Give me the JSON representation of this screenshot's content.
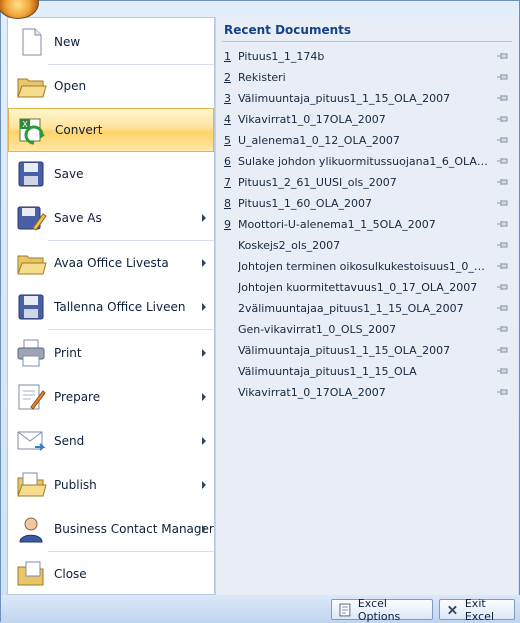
{
  "menu": {
    "items": [
      {
        "label": "New",
        "icon": "new-document-icon",
        "submenu": false
      },
      {
        "label": "Open",
        "icon": "open-folder-icon",
        "submenu": false
      },
      {
        "label": "Convert",
        "icon": "convert-icon",
        "submenu": false,
        "highlighted": true
      },
      {
        "label": "Save",
        "icon": "save-disk-icon",
        "submenu": false
      },
      {
        "label": "Save As",
        "icon": "save-as-icon",
        "submenu": true
      },
      {
        "label": "Avaa Office Livesta",
        "icon": "open-folder-icon",
        "submenu": true
      },
      {
        "label": "Tallenna Office Liveen",
        "icon": "save-disk-icon",
        "submenu": true
      },
      {
        "label": "Print",
        "icon": "printer-icon",
        "submenu": true
      },
      {
        "label": "Prepare",
        "icon": "prepare-icon",
        "submenu": true
      },
      {
        "label": "Send",
        "icon": "send-icon",
        "submenu": true
      },
      {
        "label": "Publish",
        "icon": "publish-folder-icon",
        "submenu": true
      },
      {
        "label": "Business Contact Manager",
        "icon": "contact-person-icon",
        "submenu": true
      },
      {
        "label": "Close",
        "icon": "close-folder-icon",
        "submenu": false
      }
    ]
  },
  "recent": {
    "title": "Recent Documents",
    "items": [
      {
        "num": "1",
        "name": "Pituus1_1_174b"
      },
      {
        "num": "2",
        "name": "Rekisteri"
      },
      {
        "num": "3",
        "name": "Välimuuntaja_pituus1_1_15_OLA_2007"
      },
      {
        "num": "4",
        "name": "Vikavirrat1_0_17OLA_2007"
      },
      {
        "num": "5",
        "name": "U_alenema1_0_12_OLA_2007"
      },
      {
        "num": "6",
        "name": "Sulake johdon ylikuormitussuojana1_6_OLA_2..."
      },
      {
        "num": "7",
        "name": "Pituus1_2_61_UUSI_ols_2007"
      },
      {
        "num": "8",
        "name": "Pituus1_1_60_OLA_2007"
      },
      {
        "num": "9",
        "name": "Moottori-U-alenema1_1_5OLA_2007"
      },
      {
        "num": "",
        "name": "Koskejs2_ols_2007"
      },
      {
        "num": "",
        "name": "Johtojen terminen oikosulkukestoisuus1_0_7_..."
      },
      {
        "num": "",
        "name": "Johtojen kuormitettavuus1_0_17_OLA_2007"
      },
      {
        "num": "",
        "name": "2välimuuntajaa_pituus1_1_15_OLA_2007"
      },
      {
        "num": "",
        "name": "Gen-vikavirrat1_0_OLS_2007"
      },
      {
        "num": "",
        "name": "Välimuuntaja_pituus1_1_15_OLA_2007"
      },
      {
        "num": "",
        "name": "Välimuuntaja_pituus1_1_15_OLA"
      },
      {
        "num": "",
        "name": "Vikavirrat1_0_17OLA_2007"
      }
    ]
  },
  "footer": {
    "options_label": "Excel Options",
    "exit_label": "Exit Excel"
  },
  "colors": {
    "highlight": "#ffd36a",
    "title_blue": "#15428b",
    "frame": "#6d8fbd"
  }
}
